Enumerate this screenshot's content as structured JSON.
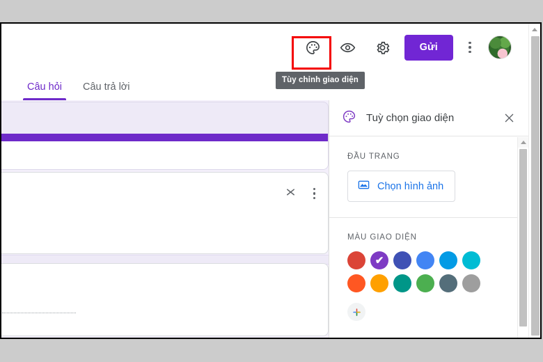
{
  "toolbar": {
    "theme_icon": "palette-icon",
    "preview_icon": "eye-icon",
    "settings_icon": "gear-icon",
    "send_label": "Gửi",
    "more_icon": "kebab-menu-icon",
    "avatar_icon": "user-avatar",
    "tooltip_text": "Tùy chỉnh giao diện"
  },
  "tabs": [
    {
      "label": "Câu hỏi",
      "active": true
    },
    {
      "label": "Câu trả lời",
      "active": false
    }
  ],
  "form_card": {
    "collapse_icon": "collapse-expand-icon",
    "more_icon": "kebab-menu-icon"
  },
  "panel": {
    "icon": "palette-icon",
    "title": "Tuỳ chọn giao diện",
    "close_icon": "close-icon",
    "header_section": {
      "label": "ĐẦU TRANG",
      "button_label": "Chọn hình ảnh",
      "button_icon": "image-icon"
    },
    "color_section": {
      "label": "MÀU GIAO DIỆN",
      "add_label": "+",
      "add_icon": "add-color-icon",
      "selected_index": 1,
      "check_glyph": "✔",
      "swatches": [
        {
          "name": "red",
          "hex": "#db4437"
        },
        {
          "name": "purple",
          "hex": "#7e3bc4"
        },
        {
          "name": "indigo",
          "hex": "#3f51b5"
        },
        {
          "name": "blue",
          "hex": "#4285f4"
        },
        {
          "name": "light-blue",
          "hex": "#039be5"
        },
        {
          "name": "cyan",
          "hex": "#00bcd4"
        },
        {
          "name": "deep-orange",
          "hex": "#ff5722"
        },
        {
          "name": "amber",
          "hex": "#ffa000"
        },
        {
          "name": "teal",
          "hex": "#009688"
        },
        {
          "name": "green",
          "hex": "#4caf50"
        },
        {
          "name": "blue-grey",
          "hex": "#546e7a"
        },
        {
          "name": "grey",
          "hex": "#9e9e9e"
        }
      ]
    }
  },
  "theme": {
    "accent_purple": "#6e2ac9",
    "send_button_purple": "#7126d4",
    "canvas_lavender": "#f3effa",
    "annotation_red": "#f40000",
    "tooltip_grey": "#5f6368"
  },
  "scrollbars": {
    "panel_scroll_icon": "scroll-up-arrow",
    "main_scroll_icon": "scroll-up-arrow"
  }
}
